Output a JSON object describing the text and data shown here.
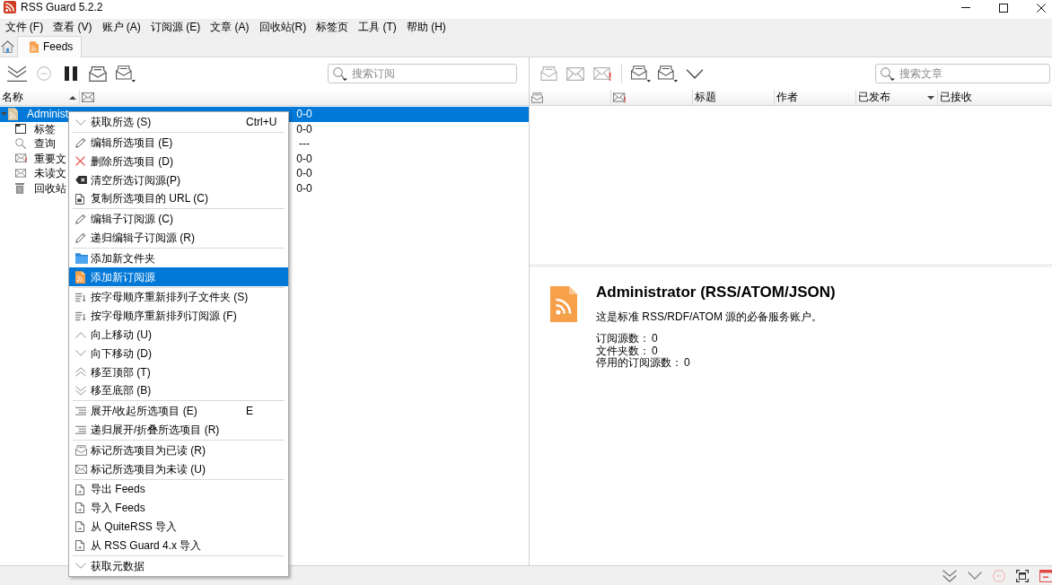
{
  "window": {
    "title": "RSS Guard 5.2.2"
  },
  "menu_bar": [
    "文件 (F)",
    "查看 (V)",
    "账户 (A)",
    "订阅源 (E)",
    "文章 (A)",
    "回收站(R)",
    "标签页",
    "工具 (T)",
    "帮助 (H)"
  ],
  "tabs": [
    {
      "label": "Feeds",
      "selected": true
    }
  ],
  "feeds_pane": {
    "search": {
      "placeholder": "搜索订阅"
    },
    "columns": [
      {
        "kind": "text",
        "label": "名称",
        "sort_up": true,
        "sort_down": false
      },
      {
        "kind": "unread",
        "sort_up": false,
        "sort_down": false
      }
    ],
    "tree": [
      {
        "kind": "account",
        "label": "Administ",
        "count": "0-0",
        "selected": true,
        "expanded": true,
        "children": [
          {
            "kind": "labels",
            "label": "标签",
            "count": "0-0",
            "selected": false
          },
          {
            "kind": "queries",
            "label": "查询",
            "count": "---",
            "selected": false
          },
          {
            "kind": "important",
            "label": "重要文",
            "count": "0-0",
            "selected": false
          },
          {
            "kind": "unread",
            "label": "未读文",
            "count": "0-0",
            "selected": false
          },
          {
            "kind": "recycle",
            "label": "回收站",
            "count": "0-0",
            "selected": false
          }
        ]
      }
    ]
  },
  "articles_pane": {
    "search": {
      "placeholder": "搜索文章"
    },
    "columns": [
      {
        "kind": "read",
        "sort_up": false,
        "sort_down": false
      },
      {
        "kind": "important",
        "sort_up": false,
        "sort_down": false
      },
      {
        "kind": "text",
        "label": "标题",
        "sort_up": false,
        "sort_down": false
      },
      {
        "kind": "text",
        "label": "作者",
        "sort_up": false,
        "sort_down": false
      },
      {
        "kind": "text",
        "label": "已发布",
        "sort_up": false,
        "sort_down": true
      },
      {
        "kind": "text",
        "label": "已接收",
        "sort_up": false,
        "sort_down": false
      }
    ]
  },
  "detail": {
    "title": "Administrator (RSS/ATOM/JSON)",
    "description": "这是标准 RSS/RDF/ATOM 源的必备服务账户。",
    "stats": [
      {
        "label": "订阅源数：",
        "value": "0"
      },
      {
        "label": "文件夹数：",
        "value": "0"
      },
      {
        "label": "停用的订阅源数：",
        "value": "0"
      }
    ]
  },
  "context_menu": {
    "groups": [
      [
        {
          "label": "获取所选 (S)",
          "shortcut": "Ctrl+U",
          "selected": false
        }
      ],
      [
        {
          "label": "编辑所选项目 (E)",
          "selected": false
        },
        {
          "label": "删除所选项目 (D)",
          "selected": false
        },
        {
          "label": "清空所选订阅源(P)",
          "selected": false
        },
        {
          "label": "复制所选项目的 URL (C)",
          "selected": false
        }
      ],
      [
        {
          "label": "编辑子订阅源 (C)",
          "selected": false
        },
        {
          "label": "递归编辑子订阅源 (R)",
          "selected": false
        }
      ],
      [
        {
          "label": "添加新文件夹",
          "selected": false
        },
        {
          "label": "添加新订阅源",
          "selected": true
        }
      ],
      [
        {
          "label": "按字母顺序重新排列子文件夹 (S)",
          "selected": false
        },
        {
          "label": "按字母顺序重新排列订阅源 (F)",
          "selected": false
        },
        {
          "label": "向上移动 (U)",
          "selected": false
        },
        {
          "label": "向下移动 (D)",
          "selected": false
        },
        {
          "label": "移至顶部 (T)",
          "selected": false
        },
        {
          "label": "移至底部 (B)",
          "selected": false
        }
      ],
      [
        {
          "label": "展开/收起所选项目 (E)",
          "shortcut": "E",
          "selected": false
        },
        {
          "label": "递归展开/折叠所选项目 (R)",
          "selected": false
        }
      ],
      [
        {
          "label": "标记所选项目为已读 (R)",
          "selected": false
        },
        {
          "label": "标记所选项目为未读 (U)",
          "selected": false
        }
      ],
      [
        {
          "label": "导出 Feeds",
          "selected": false
        },
        {
          "label": "导入 Feeds",
          "selected": false
        },
        {
          "label": "从 QuiteRSS 导入",
          "selected": false
        },
        {
          "label": "从 RSS Guard 4.x 导入",
          "selected": false
        }
      ],
      [
        {
          "label": "获取元数据",
          "selected": false
        }
      ]
    ]
  }
}
